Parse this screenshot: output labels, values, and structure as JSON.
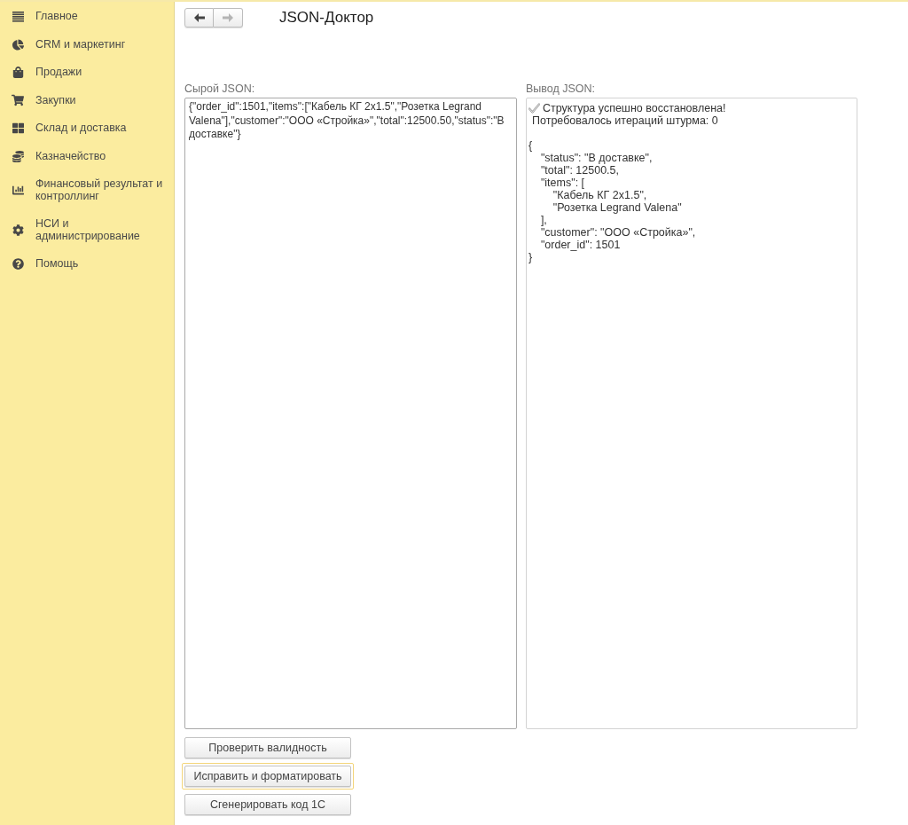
{
  "sidebar": {
    "items": [
      {
        "label": "Главное",
        "selected": false
      },
      {
        "label": "CRM и маркетинг",
        "selected": false
      },
      {
        "label": "Продажи",
        "selected": false
      },
      {
        "label": "Закупки",
        "selected": false
      },
      {
        "label": "Склад и доставка",
        "selected": false
      },
      {
        "label": "Казначейство",
        "selected": false
      },
      {
        "label": "Финансовый результат и контроллинг",
        "selected": false
      },
      {
        "label": "НСИ и администрирование",
        "selected": false
      },
      {
        "label": "Помощь",
        "selected": false
      }
    ]
  },
  "header": {
    "nav": [
      {
        "kind": "back",
        "disabled": false
      },
      {
        "kind": "forward",
        "disabled": true
      }
    ],
    "title": "JSON-Доктор"
  },
  "raw_json": {
    "label": "Сырой JSON:",
    "value": "{\"order_id\":1501,\"items\":[\"Кабель КГ 2x1.5\",\"Розетка Legrand Valena\"],\"customer\":\"ООО «Стройка»\",\"total\":12500.50,\"status\":\"В доставке\"}"
  },
  "output": {
    "label": "Вывод JSON:",
    "status": {
      "kind": "success",
      "message": "Структура успешно восстановлена!",
      "detail": "Потребовалось итераций штурма: 0"
    },
    "json_text": "{\n    \"status\": \"В доставке\",\n    \"total\": 12500.5,\n    \"items\": [\n        \"Кабель КГ 2x1.5\",\n        \"Розетка Legrand Valena\"\n    ],\n    \"customer\": \"ООО «Стройка»\",\n    \"order_id\": 1501\n}"
  },
  "buttons": [
    {
      "label": "Проверить валидность",
      "focused": false
    },
    {
      "label": "Исправить и форматировать",
      "focused": true
    },
    {
      "label": "Сгенерировать код 1С",
      "focused": false
    }
  ]
}
